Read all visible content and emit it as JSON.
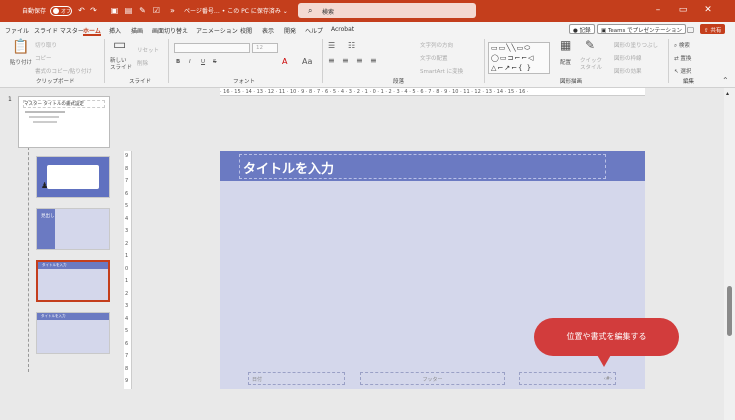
{
  "titlebar": {
    "autosave_label": "自動保存",
    "autosave_state": "オフ",
    "doc_title": "ページ番号… • この PC に保存済み ⌄",
    "search_placeholder": "検索"
  },
  "tabs": [
    {
      "label": "ファイル"
    },
    {
      "label": "スライド マスター"
    },
    {
      "label": "ホーム"
    },
    {
      "label": "挿入"
    },
    {
      "label": "描画"
    },
    {
      "label": "画面切り替え"
    },
    {
      "label": "アニメーション"
    },
    {
      "label": "校閲"
    },
    {
      "label": "表示"
    },
    {
      "label": "開発"
    },
    {
      "label": "ヘルプ"
    },
    {
      "label": "Acrobat"
    }
  ],
  "active_tab": "ホーム",
  "ribbon_right": {
    "record": "記録",
    "teams": "Teams でプレゼンテーション",
    "share": "共有"
  },
  "ribbon": {
    "clipboard": {
      "paste": "貼り付け",
      "cut": "切り取り",
      "copy": "コピー",
      "format_painter": "書式のコピー/貼り付け",
      "label": "クリップボード"
    },
    "slides": {
      "new_slide": "新しい スライド",
      "reset": "リセット",
      "section": "削除",
      "label": "スライド"
    },
    "font": {
      "size": "12",
      "bold": "B",
      "italic": "I",
      "underline": "U",
      "strike": "S",
      "label": "フォント"
    },
    "paragraph": {
      "text_direction": "文字列の方向",
      "align_text": "文字の配置",
      "smartart": "SmartArt に変換",
      "label": "段落"
    },
    "drawing": {
      "arrange": "配置",
      "quick_styles": "クイック スタイル",
      "shape_fill": "図形の塗りつぶし",
      "shape_outline": "図形の枠線",
      "shape_effects": "図形の効果",
      "label": "図形描画"
    },
    "editing": {
      "find": "検索",
      "replace": "置換",
      "select": "選択",
      "label": "編集"
    }
  },
  "thumbnails": {
    "master_number": "1",
    "master_title": "マスター タイトルの書式設定",
    "layout3_label": "見出し",
    "layout4_title": "タイトルを入力",
    "layout5_title": "タイトルを入力"
  },
  "ruler": {
    "h_ticks": "· 16 · 15 · 14 · 13 · 12 · 11 · 10 · 9 · 8 · 7 · 6 · 5 · 4 · 3 · 2 · 1 · 0 · 1 · 2 · 3 · 4 · 5 · 6 · 7 · 8 · 9 · 10 · 11 · 12 · 13 · 14 · 15 · 16 ·",
    "v_ticks": [
      "9",
      "8",
      "7",
      "6",
      "5",
      "4",
      "3",
      "2",
      "1",
      "0",
      "1",
      "2",
      "3",
      "4",
      "5",
      "6",
      "7",
      "8",
      "9"
    ]
  },
  "slide": {
    "title": "タイトルを入力",
    "date_placeholder": "日付",
    "footer_placeholder": "フッター",
    "number_placeholder": "‹#›"
  },
  "callout": {
    "text": "位置や書式を編集する"
  },
  "colors": {
    "accent": "#c43e1c",
    "slide_bar": "#6b7ac2",
    "slide_bg": "#d4d7eb",
    "callout": "#d23c3c"
  }
}
